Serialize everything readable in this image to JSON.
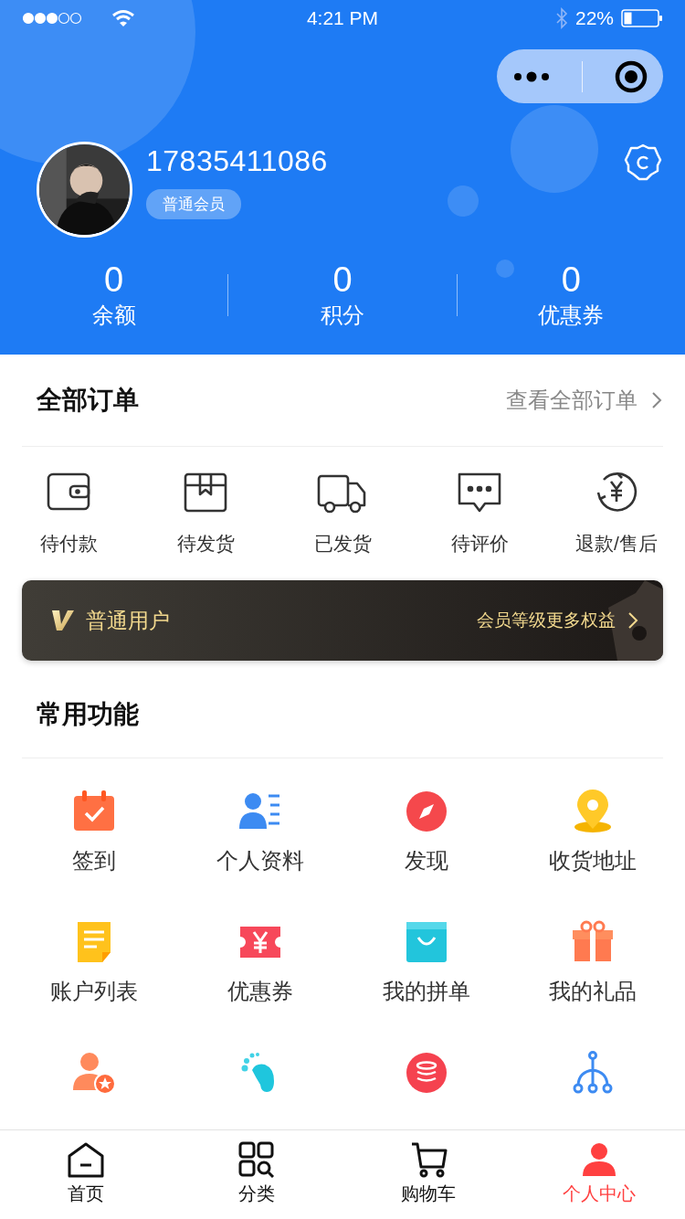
{
  "status_bar": {
    "time": "4:21 PM",
    "battery": "22%"
  },
  "profile": {
    "phone": "17835411086",
    "badge": "普通会员"
  },
  "stats": [
    {
      "value": "0",
      "label": "余额"
    },
    {
      "value": "0",
      "label": "积分"
    },
    {
      "value": "0",
      "label": "优惠券"
    }
  ],
  "orders": {
    "title": "全部订单",
    "link": "查看全部订单",
    "items": [
      {
        "kind": "wallet",
        "label": "待付款"
      },
      {
        "kind": "box",
        "label": "待发货"
      },
      {
        "kind": "truck",
        "label": "已发货"
      },
      {
        "kind": "chat",
        "label": "待评价"
      },
      {
        "kind": "refund",
        "label": "退款/售后"
      }
    ]
  },
  "vip": {
    "level": "普通用户",
    "link": "会员等级更多权益"
  },
  "functions": {
    "title": "常用功能",
    "items": [
      {
        "kind": "calendar",
        "label": "签到"
      },
      {
        "kind": "profile",
        "label": "个人资料"
      },
      {
        "kind": "compass",
        "label": "发现"
      },
      {
        "kind": "pin",
        "label": "收货地址"
      },
      {
        "kind": "document",
        "label": "账户列表"
      },
      {
        "kind": "coupon",
        "label": "优惠券"
      },
      {
        "kind": "bag",
        "label": "我的拼单"
      },
      {
        "kind": "gift",
        "label": "我的礼品"
      },
      {
        "kind": "userstar"
      },
      {
        "kind": "foot"
      },
      {
        "kind": "coins"
      },
      {
        "kind": "tree"
      }
    ]
  },
  "tab_bar": [
    {
      "kind": "home",
      "label": "首页",
      "selected": false
    },
    {
      "kind": "grid",
      "label": "分类",
      "selected": false
    },
    {
      "kind": "cart",
      "label": "购物车",
      "selected": false
    },
    {
      "kind": "user",
      "label": "个人中心",
      "selected": true
    }
  ]
}
